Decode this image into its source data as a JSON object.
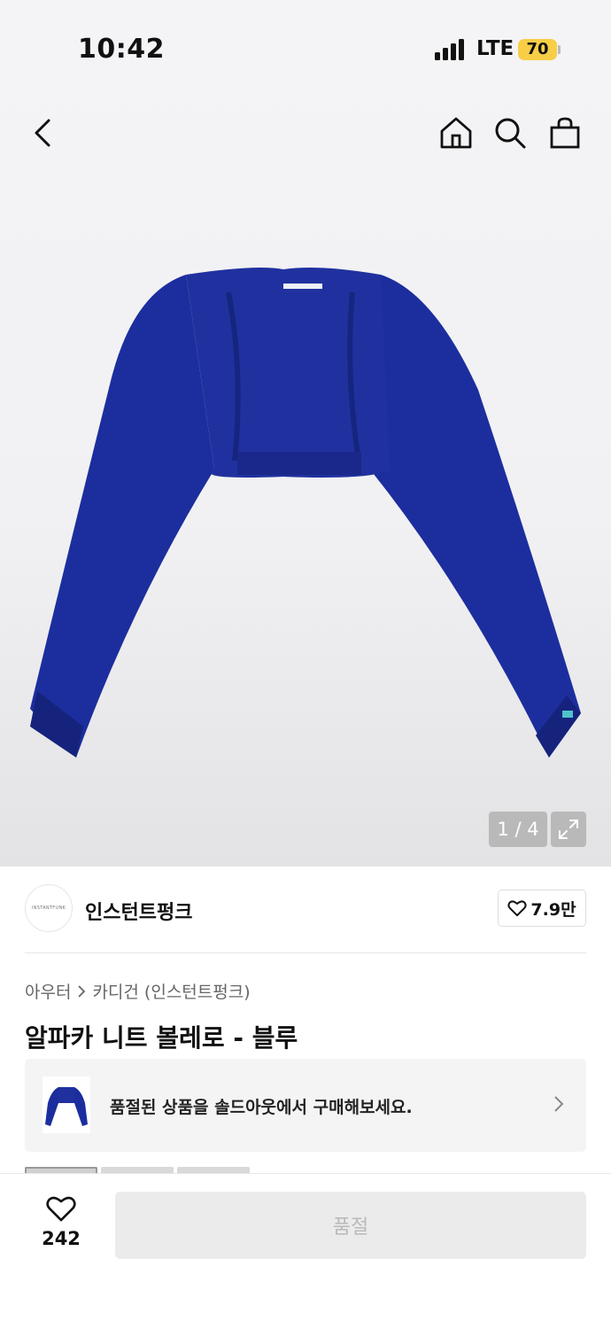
{
  "status_bar": {
    "time": "10:42",
    "network": "LTE",
    "battery": "70"
  },
  "header": {
    "back_icon": "chevron-left-icon",
    "home_icon": "home-icon",
    "search_icon": "search-icon",
    "cart_icon": "shopping-bag-icon"
  },
  "gallery": {
    "product_image": "blue-alpaca-knit-bolero",
    "counter": "1 / 4",
    "expand_icon": "expand-icon"
  },
  "brand": {
    "logo_text": "INSTANTFUNK",
    "name": "인스턴트펑크",
    "like_count": "7.9만"
  },
  "breadcrumb": {
    "category": "아우터",
    "subcategory": "카디건 (인스턴트펑크)"
  },
  "product": {
    "title": "알파카 니트 볼레로 - 블루"
  },
  "soldout_banner": {
    "text": "품절된 상품을 솔드아웃에서 구매해보세요."
  },
  "bottom_bar": {
    "like_count": "242",
    "buy_label": "품절"
  },
  "colors": {
    "product_blue": "#1c2e9e",
    "battery_yellow": "#f7ce46",
    "disabled_button": "#ebebeb"
  }
}
